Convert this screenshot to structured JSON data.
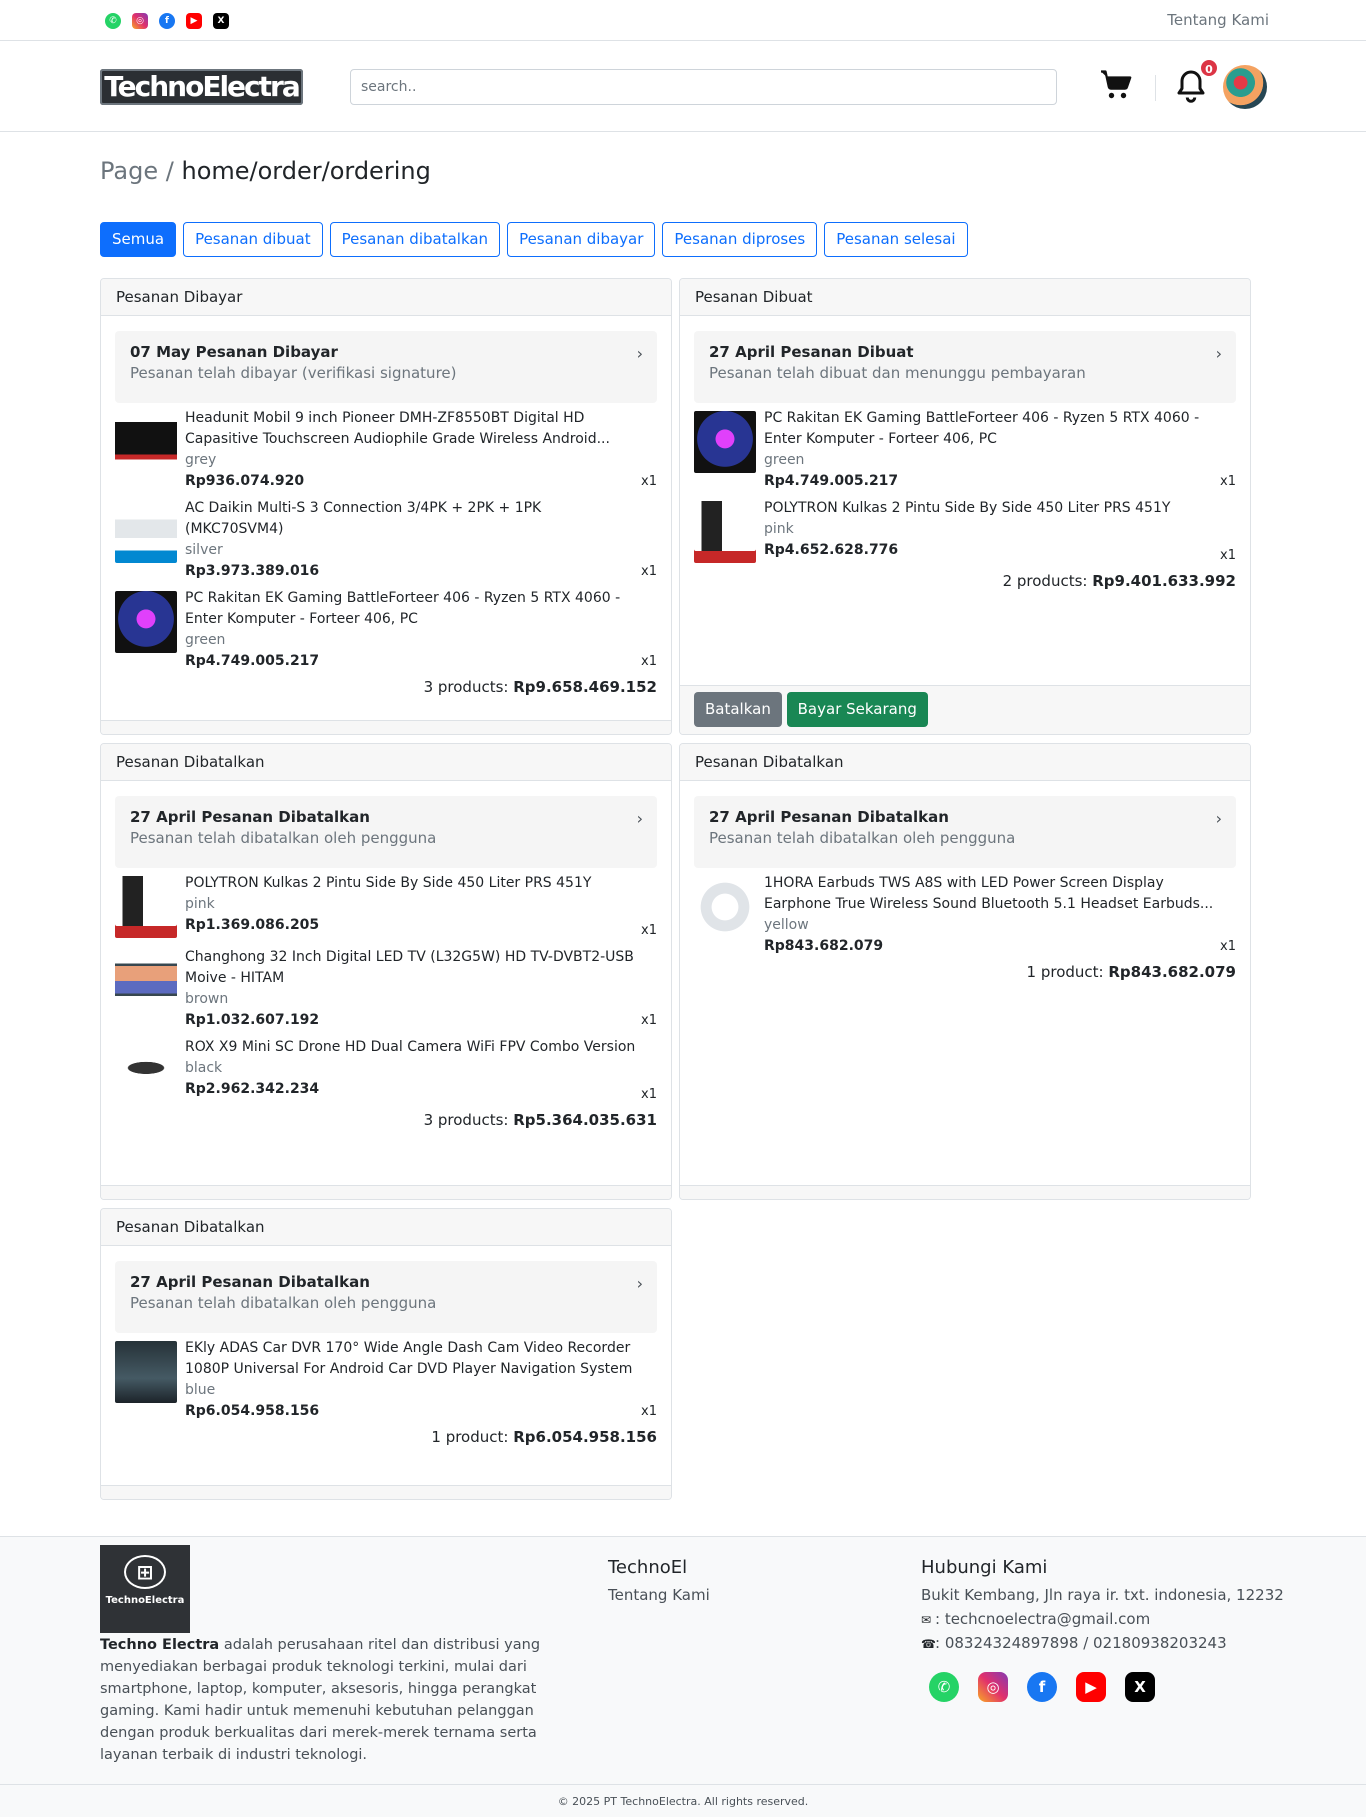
{
  "topbar": {
    "about_label": "Tentang Kami"
  },
  "header": {
    "logo_text": "TechnoElectra",
    "search_placeholder": "search..",
    "notif_count": "0"
  },
  "breadcrumb": {
    "prefix": "Page",
    "sep": "/",
    "current": "home/order/ordering"
  },
  "tabs": [
    "Semua",
    "Pesanan dibuat",
    "Pesanan dibatalkan",
    "Pesanan dibayar",
    "Pesanan diproses",
    "Pesanan selesai"
  ],
  "orders": [
    {
      "header": "Pesanan Dibayar",
      "title": "07 May Pesanan Dibayar",
      "subtitle": "Pesanan telah dibayar (verifikasi signature)",
      "items": [
        {
          "name": "Headunit Mobil 9 inch Pioneer DMH-ZF8550BT Digital HD Capasitive Touchscreen Audiophile Grade Wireless Android...",
          "variant": "grey",
          "price": "Rp936.074.920",
          "qty": "x1"
        },
        {
          "name": "AC Daikin Multi-S 3 Connection 3/4PK + 2PK + 1PK (MKC70SVM4)",
          "variant": "silver",
          "price": "Rp3.973.389.016",
          "qty": "x1"
        },
        {
          "name": "PC Rakitan EK Gaming BattleForteer 406 - Ryzen 5 RTX 4060 - Enter Komputer - Forteer 406, PC",
          "variant": "green",
          "price": "Rp4.749.005.217",
          "qty": "x1"
        }
      ],
      "total_label": "3 products:",
      "total_value": "Rp9.658.469.152"
    },
    {
      "header": "Pesanan Dibuat",
      "title": "27 April Pesanan Dibuat",
      "subtitle": "Pesanan telah dibuat dan menunggu pembayaran",
      "items": [
        {
          "name": "PC Rakitan EK Gaming BattleForteer 406 - Ryzen 5 RTX 4060 - Enter Komputer - Forteer 406, PC",
          "variant": "green",
          "price": "Rp4.749.005.217",
          "qty": "x1"
        },
        {
          "name": "POLYTRON Kulkas 2 Pintu Side By Side 450 Liter PRS 451Y",
          "variant": "pink",
          "price": "Rp4.652.628.776",
          "qty": "x1"
        }
      ],
      "total_label": "2 products:",
      "total_value": "Rp9.401.633.992",
      "cancel_label": "Batalkan",
      "pay_label": "Bayar Sekarang"
    },
    {
      "header": "Pesanan Dibatalkan",
      "title": "27 April Pesanan Dibatalkan",
      "subtitle": "Pesanan telah dibatalkan oleh pengguna",
      "items": [
        {
          "name": "POLYTRON Kulkas 2 Pintu Side By Side 450 Liter PRS 451Y",
          "variant": "pink",
          "price": "Rp1.369.086.205",
          "qty": "x1"
        },
        {
          "name": "Changhong 32 Inch Digital LED TV (L32G5W) HD TV-DVBT2-USB Moive - HITAM",
          "variant": "brown",
          "price": "Rp1.032.607.192",
          "qty": "x1"
        },
        {
          "name": "ROX X9 Mini SC Drone HD Dual Camera WiFi FPV Combo Version",
          "variant": "black",
          "price": "Rp2.962.342.234",
          "qty": "x1"
        }
      ],
      "total_label": "3 products:",
      "total_value": "Rp5.364.035.631"
    },
    {
      "header": "Pesanan Dibatalkan",
      "title": "27 April Pesanan Dibatalkan",
      "subtitle": "Pesanan telah dibatalkan oleh pengguna",
      "items": [
        {
          "name": "1HORA Earbuds TWS A8S with LED Power Screen Display Earphone True Wireless Sound Bluetooth 5.1 Headset Earbuds...",
          "variant": "yellow",
          "price": "Rp843.682.079",
          "qty": "x1"
        }
      ],
      "total_label": "1 product:",
      "total_value": "Rp843.682.079"
    },
    {
      "header": "Pesanan Dibatalkan",
      "title": "27 April Pesanan Dibatalkan",
      "subtitle": "Pesanan telah dibatalkan oleh pengguna",
      "items": [
        {
          "name": "EKly ADAS Car DVR 170° Wide Angle Dash Cam Video Recorder 1080P Universal For Android Car DVD Player Navigation System",
          "variant": "blue",
          "price": "Rp6.054.958.156",
          "qty": "x1"
        }
      ],
      "total_label": "1 product:",
      "total_value": "Rp6.054.958.156"
    }
  ],
  "footer": {
    "logo_text": "TechnoElectra",
    "desc_brand": "Techno Electra",
    "desc_rest": " adalah perusahaan ritel dan distribusi yang menyediakan berbagai produk teknologi terkini, mulai dari smartphone, laptop, komputer, aksesoris, hingga perangkat gaming. Kami hadir untuk memenuhi kebutuhan pelanggan dengan produk berkualitas dari merek-merek ternama serta layanan terbaik di industri teknologi.",
    "col1_title": "TechnoEl",
    "col1_link": "Tentang Kami",
    "col2_title": "Hubungi Kami",
    "address": "Bukit Kembang, Jln raya ir. txt. indonesia, 12232",
    "email": ": techcnoelectra@gmail.com",
    "phone": ": 08324324897898 / 02180938203243",
    "copyright": "© 2025 PT TechnoElectra. All rights reserved."
  },
  "icons": [
    "whatsapp-icon",
    "instagram-icon",
    "facebook-icon",
    "youtube-icon",
    "x-icon",
    "cart-icon",
    "bell-icon",
    "chevron-right-icon",
    "envelope-icon",
    "phone-icon"
  ]
}
